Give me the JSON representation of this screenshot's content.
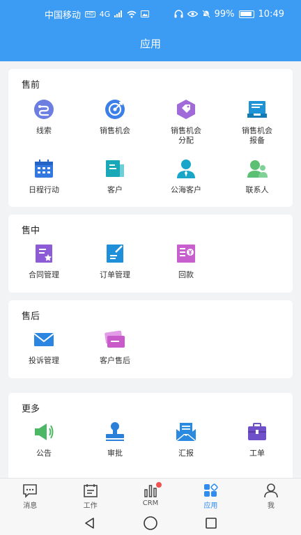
{
  "status_bar": {
    "carrier": "中国移动",
    "hd": "HD",
    "net": "4G",
    "battery": "99%",
    "time": "10:49"
  },
  "header": {
    "title": "应用"
  },
  "sections": [
    {
      "title": "售前",
      "items": [
        {
          "label": "线索",
          "icon": "clue-icon"
        },
        {
          "label": "销售机会",
          "icon": "target-icon"
        },
        {
          "label": "销售机会\n分配",
          "icon": "tag-icon"
        },
        {
          "label": "销售机会\n报备",
          "icon": "report-box-icon"
        },
        {
          "label": "日程行动",
          "icon": "calendar-icon"
        },
        {
          "label": "客户",
          "icon": "customer-icon"
        },
        {
          "label": "公海客户",
          "icon": "public-customer-icon"
        },
        {
          "label": "联系人",
          "icon": "contacts-icon"
        }
      ]
    },
    {
      "title": "售中",
      "items": [
        {
          "label": "合同管理",
          "icon": "contract-icon"
        },
        {
          "label": "订单管理",
          "icon": "order-icon"
        },
        {
          "label": "回款",
          "icon": "payment-icon"
        }
      ]
    },
    {
      "title": "售后",
      "items": [
        {
          "label": "投诉管理",
          "icon": "mail-icon"
        },
        {
          "label": "客户售后",
          "icon": "card-icon"
        }
      ]
    },
    {
      "title": "更多",
      "items": [
        {
          "label": "公告",
          "icon": "megaphone-icon"
        },
        {
          "label": "审批",
          "icon": "stamp-icon"
        },
        {
          "label": "汇报",
          "icon": "envelope-icon"
        },
        {
          "label": "工单",
          "icon": "briefcase-icon"
        }
      ]
    }
  ],
  "tabs": [
    {
      "label": "消息",
      "icon": "message-icon"
    },
    {
      "label": "工作",
      "icon": "work-icon"
    },
    {
      "label": "CRM",
      "icon": "crm-chart-icon",
      "badge": true
    },
    {
      "label": "应用",
      "icon": "apps-icon",
      "active": true
    },
    {
      "label": "我",
      "icon": "profile-icon"
    }
  ],
  "colors": {
    "header_bg": "#3c9bf3",
    "accent": "#2f8cf0",
    "badge": "#f0524f"
  }
}
